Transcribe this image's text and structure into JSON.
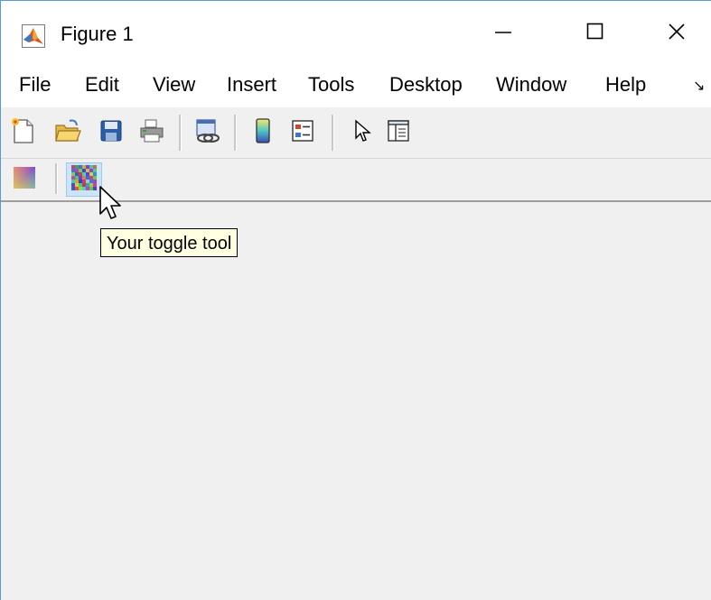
{
  "window": {
    "title": "Figure 1",
    "controls": {
      "minimize": "minimize-icon",
      "maximize": "maximize-icon",
      "close": "close-icon"
    }
  },
  "menubar": {
    "items": [
      "File",
      "Edit",
      "View",
      "Insert",
      "Tools",
      "Desktop",
      "Window",
      "Help"
    ],
    "overflow_icon": "overflow-chevron-icon"
  },
  "toolbar": {
    "icons": [
      "new-figure-icon",
      "open-file-icon",
      "save-icon",
      "print-icon",
      "link-plot-icon",
      "insert-colorbar-icon",
      "insert-legend-icon",
      "edit-plot-icon",
      "property-inspector-icon"
    ]
  },
  "custom_toolbar": {
    "icons": [
      "gradient-push-tool-icon",
      "noise-toggle-tool-icon"
    ],
    "toggle_pressed": true
  },
  "tooltip": {
    "text": "Your toggle tool"
  },
  "colors": {
    "window_border": "#5a9bd5",
    "background": "#f0f0f0",
    "tooltip_bg": "#ffffe1",
    "toggle_highlight": "#cce4f7"
  }
}
